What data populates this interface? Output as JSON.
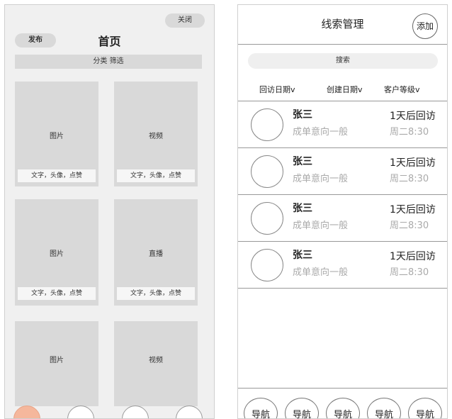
{
  "home": {
    "close_label": "关闭",
    "publish_label": "发布",
    "title": "首页",
    "filter_label": "分类 筛选",
    "cards": [
      {
        "title": "图片",
        "info": "文字，头像，点赞"
      },
      {
        "title": "视频",
        "info": "文字，头像，点赞"
      },
      {
        "title": "图片",
        "info": "文字，头像，点赞"
      },
      {
        "title": "直播",
        "info": "文字，头像，点赞"
      },
      {
        "title": "图片",
        "info": ""
      },
      {
        "title": "视频",
        "info": ""
      }
    ],
    "accent_color": "#f5b79c"
  },
  "leads": {
    "title": "线索管理",
    "add_label": "添加",
    "search_label": "搜索",
    "filters": [
      "回访日期v",
      "创建日期v",
      "客户等级v"
    ],
    "items": [
      {
        "name": "张三",
        "intent": "成单意向一般",
        "followup": "1天后回访",
        "when": "周二8:30"
      },
      {
        "name": "张三",
        "intent": "成单意向一般",
        "followup": "1天后回访",
        "when": "周二8:30"
      },
      {
        "name": "张三",
        "intent": "成单意向一般",
        "followup": "1天后回访",
        "when": "周二8:30"
      },
      {
        "name": "张三",
        "intent": "成单意向一般",
        "followup": "1天后回访",
        "when": "周二8:30"
      }
    ],
    "nav": [
      "导航",
      "导航",
      "导航",
      "导航",
      "导航"
    ]
  }
}
